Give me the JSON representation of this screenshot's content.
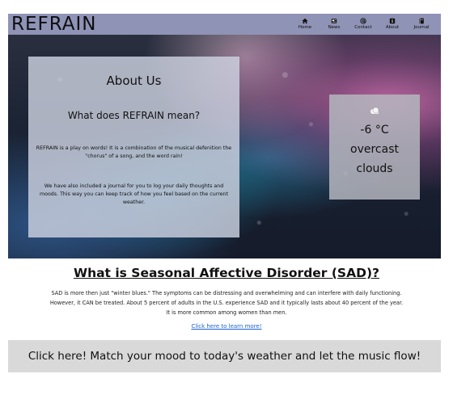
{
  "header": {
    "brand": "REFRAIN",
    "nav": [
      {
        "label": "Home",
        "icon": "home-icon"
      },
      {
        "label": "News",
        "icon": "news-icon"
      },
      {
        "label": "Contact",
        "icon": "at-icon"
      },
      {
        "label": "About",
        "icon": "info-icon"
      },
      {
        "label": "Journal",
        "icon": "journal-icon"
      }
    ],
    "bar_color": "#8f93b5"
  },
  "about": {
    "title": "About Us",
    "subtitle": "What does REFRAIN mean?",
    "paragraph1": "REFRAIN is a play on words! It is a combination of the musical defenition the \"chorus\" of a song, and the word rain!",
    "paragraph2": "We have also included a journal for you to log your daily thoughts and moods. This way you can keep track of how you feel based on the current weather."
  },
  "weather": {
    "icon": "cloud-icon",
    "temperature": "-6 °C",
    "description_line1": "overcast",
    "description_line2": "clouds"
  },
  "sad": {
    "title": "What is Seasonal Affective Disorder (SAD)?",
    "text": "SAD is more then just \"winter blues.\" The symptoms can be distressing and overwhelming and can interfere with daily functioning. However, it CAN be treated. About 5 percent of adults in the U.S. experience SAD and it typically lasts about 40 percent of the year. It is more common among women than men.",
    "link": "Click here to learn more!"
  },
  "cta": {
    "label": "Click here! Match your mood to today's weather and let the music flow!"
  }
}
